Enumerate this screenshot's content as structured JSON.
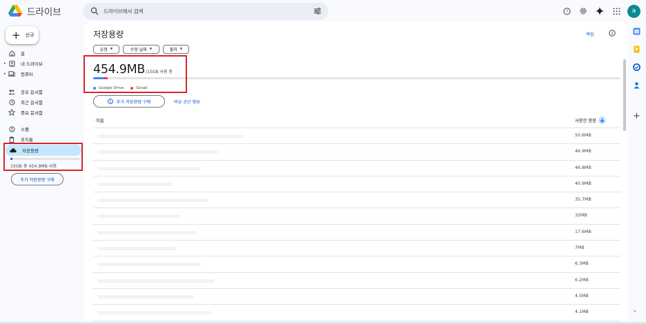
{
  "app": {
    "name": "드라이브",
    "avatar_letter": "a"
  },
  "search": {
    "placeholder": "드라이브에서 검색"
  },
  "top_icons": [
    "help-icon",
    "settings-icon",
    "gemini-icon",
    "apps-icon"
  ],
  "sidebar": {
    "new_label": "신규",
    "items": [
      {
        "label": "홈",
        "icon": "home-icon",
        "caret": false
      },
      {
        "label": "내 드라이브",
        "icon": "my-drive-icon",
        "caret": true
      },
      {
        "label": "컴퓨터",
        "icon": "computer-icon",
        "caret": true
      },
      {
        "label": "공유 문서함",
        "icon": "shared-icon",
        "caret": false
      },
      {
        "label": "최근 문서함",
        "icon": "recent-icon",
        "caret": false
      },
      {
        "label": "중요 문서함",
        "icon": "star-icon",
        "caret": false
      },
      {
        "label": "스팸",
        "icon": "spam-icon",
        "caret": false
      },
      {
        "label": "휴지통",
        "icon": "trash-icon",
        "caret": false
      },
      {
        "label": "저장용량",
        "icon": "cloud-icon",
        "caret": false,
        "active": true
      }
    ],
    "storage_text": "15GB 중 454.9MB 사용",
    "storage_fraction": 0.03,
    "buy_label": "추가 저장용량 구매"
  },
  "main": {
    "title": "저장용량",
    "backup_label": "백업",
    "filters": [
      {
        "label": "유형"
      },
      {
        "label": "수정 날짜"
      },
      {
        "label": "출처"
      }
    ],
    "usage_value": "454.9MB",
    "usage_total": "/15GB 사용 중",
    "usage_fraction_drive": 0.021,
    "usage_fraction_gmail": 0.007,
    "legend": [
      {
        "label": "Google Drive",
        "color": "#4285f4"
      },
      {
        "label": "Gmail",
        "color": "#ea4335"
      }
    ],
    "buy_label": "추가 저장용량 구매",
    "free_space_label": "여유 공간 확보",
    "col_name": "이름",
    "col_used": "사용한 용량",
    "rows": [
      {
        "size": "50.6MB"
      },
      {
        "size": "46.9MB"
      },
      {
        "size": "46.8MB"
      },
      {
        "size": "40.9MB"
      },
      {
        "size": "35.7MB"
      },
      {
        "size": "32MB"
      },
      {
        "size": "17.6MB"
      },
      {
        "size": "7MB"
      },
      {
        "size": "6.3MB"
      },
      {
        "size": "6.2MB"
      },
      {
        "size": "4.5MB"
      },
      {
        "size": "4.1MB"
      }
    ]
  },
  "rail": [
    "calendar-icon",
    "keep-icon",
    "tasks-icon",
    "contacts-icon"
  ],
  "colors": {
    "accent": "#0b57d0",
    "active_bg": "#c2e7ff",
    "highlight": "#d9232b"
  }
}
